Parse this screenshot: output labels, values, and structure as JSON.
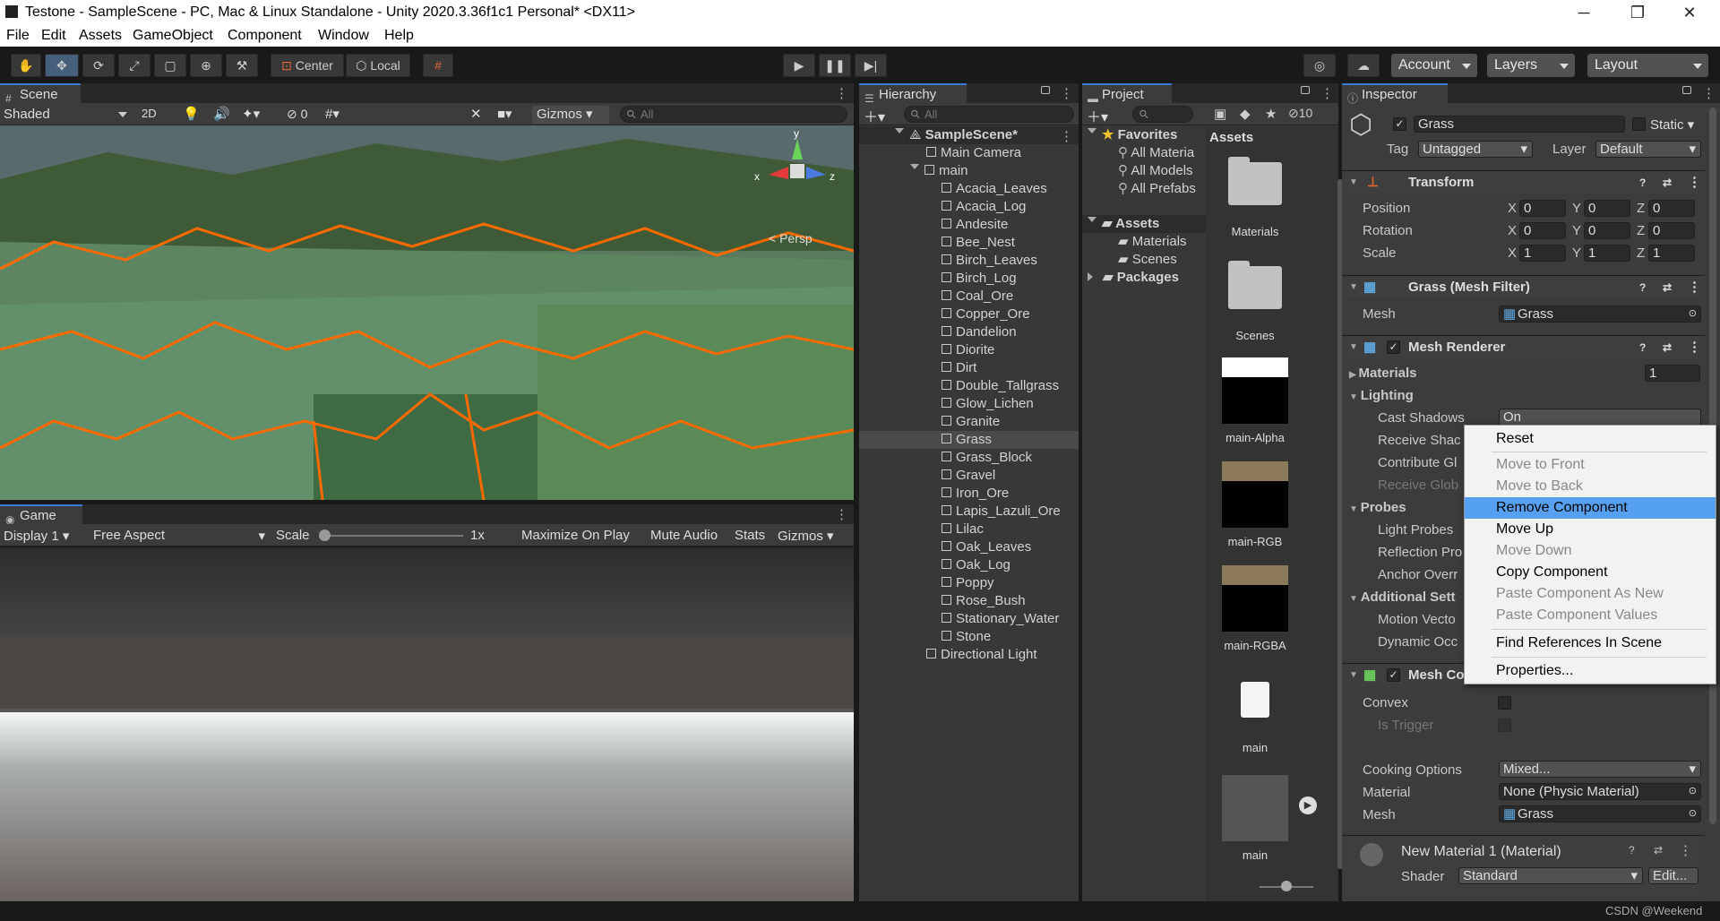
{
  "window": {
    "title": "Testone - SampleScene - PC, Mac & Linux Standalone - Unity 2020.3.36f1c1 Personal* <DX11>"
  },
  "menubar": [
    "File",
    "Edit",
    "Assets",
    "GameObject",
    "Component",
    "Window",
    "Help"
  ],
  "toolbar": {
    "center": "Center",
    "local": "Local",
    "account": "Account",
    "layers": "Layers",
    "layout": "Layout"
  },
  "scene": {
    "tab": "Scene",
    "shading": "Shaded",
    "mode2d": "2D",
    "hidden_count": "0",
    "gizmos": "Gizmos",
    "search_placeholder": "All",
    "persp": "< Persp",
    "axis": {
      "x": "x",
      "y": "y",
      "z": "z"
    }
  },
  "game": {
    "tab": "Game",
    "display": "Display 1",
    "aspect": "Free Aspect",
    "scale_label": "Scale",
    "scale_value": "1x",
    "maximize": "Maximize On Play",
    "mute": "Mute Audio",
    "stats": "Stats",
    "gizmos": "Gizmos"
  },
  "hierarchy": {
    "tab": "Hierarchy",
    "search_placeholder": "All",
    "scene": "SampleScene*",
    "camera": "Main Camera",
    "main": "main",
    "children": [
      "Acacia_Leaves",
      "Acacia_Log",
      "Andesite",
      "Bee_Nest",
      "Birch_Leaves",
      "Birch_Log",
      "Coal_Ore",
      "Copper_Ore",
      "Dandelion",
      "Diorite",
      "Dirt",
      "Double_Tallgrass",
      "Glow_Lichen",
      "Granite",
      "Grass",
      "Grass_Block",
      "Gravel",
      "Iron_Ore",
      "Lapis_Lazuli_Ore",
      "Lilac",
      "Oak_Leaves",
      "Oak_Log",
      "Poppy",
      "Rose_Bush",
      "Stationary_Water",
      "Stone"
    ],
    "light": "Directional Light",
    "selected": "Grass"
  },
  "project": {
    "tab": "Project",
    "hidden_count": "10",
    "favorites": "Favorites",
    "fav_items": [
      "All Materia",
      "All Models",
      "All Prefabs"
    ],
    "assets": "Assets",
    "asset_folders": [
      "Materials",
      "Scenes"
    ],
    "packages": "Packages",
    "header": "Assets",
    "items": [
      "Materials",
      "Scenes",
      "main-Alpha",
      "main-RGB",
      "main-RGBA",
      "main",
      "main"
    ]
  },
  "inspector": {
    "tab": "Inspector",
    "name": "Grass",
    "static": "Static",
    "tag_label": "Tag",
    "tag": "Untagged",
    "layer_label": "Layer",
    "layer": "Default",
    "transform": {
      "title": "Transform",
      "rows": [
        {
          "label": "Position",
          "x": "0",
          "y": "0",
          "z": "0"
        },
        {
          "label": "Rotation",
          "x": "0",
          "y": "0",
          "z": "0"
        },
        {
          "label": "Scale",
          "x": "1",
          "y": "1",
          "z": "1"
        }
      ]
    },
    "mesh_filter": {
      "title": "Grass (Mesh Filter)",
      "mesh_label": "Mesh",
      "mesh": "Grass"
    },
    "mesh_renderer": {
      "title": "Mesh Renderer",
      "materials": "Materials",
      "materials_count": "1",
      "lighting": "Lighting",
      "cast_shadows": "Cast Shadows",
      "cast_shadows_value": "On",
      "receive_shadows": "Receive Shac",
      "contribute_gi": "Contribute Gl",
      "receive_gi": "Receive Glob",
      "probes": "Probes",
      "light_probes": "Light Probes",
      "reflection_probes": "Reflection Pro",
      "anchor_override": "Anchor Overr",
      "additional": "Additional Sett",
      "motion_vectors": "Motion Vecto",
      "dynamic_occlusion": "Dynamic Occ"
    },
    "mesh_collider": {
      "title": "Mesh Co",
      "convex": "Convex",
      "is_trigger": "Is Trigger",
      "cooking_label": "Cooking Options",
      "cooking": "Mixed...",
      "material_label": "Material",
      "material": "None (Physic Material)",
      "mesh_label": "Mesh",
      "mesh": "Grass"
    },
    "material": {
      "title": "New Material 1 (Material)",
      "shader_label": "Shader",
      "shader": "Standard",
      "edit": "Edit..."
    }
  },
  "context_menu": [
    {
      "label": "Reset",
      "disabled": false
    },
    {
      "label": "Move to Front",
      "disabled": true
    },
    {
      "label": "Move to Back",
      "disabled": true
    },
    {
      "label": "Remove Component",
      "disabled": false,
      "highlighted": true
    },
    {
      "label": "Move Up",
      "disabled": false
    },
    {
      "label": "Move Down",
      "disabled": true
    },
    {
      "label": "Copy Component",
      "disabled": false
    },
    {
      "label": "Paste Component As New",
      "disabled": true
    },
    {
      "label": "Paste Component Values",
      "disabled": true
    },
    {
      "label": "Find References In Scene",
      "disabled": false
    },
    {
      "label": "Properties...",
      "disabled": false
    }
  ],
  "watermark": "CSDN @Weekend",
  "colors": {
    "accent": "#3a7ad5",
    "selection_outline": "#ff6a00",
    "highlight": "#56a0f2"
  }
}
